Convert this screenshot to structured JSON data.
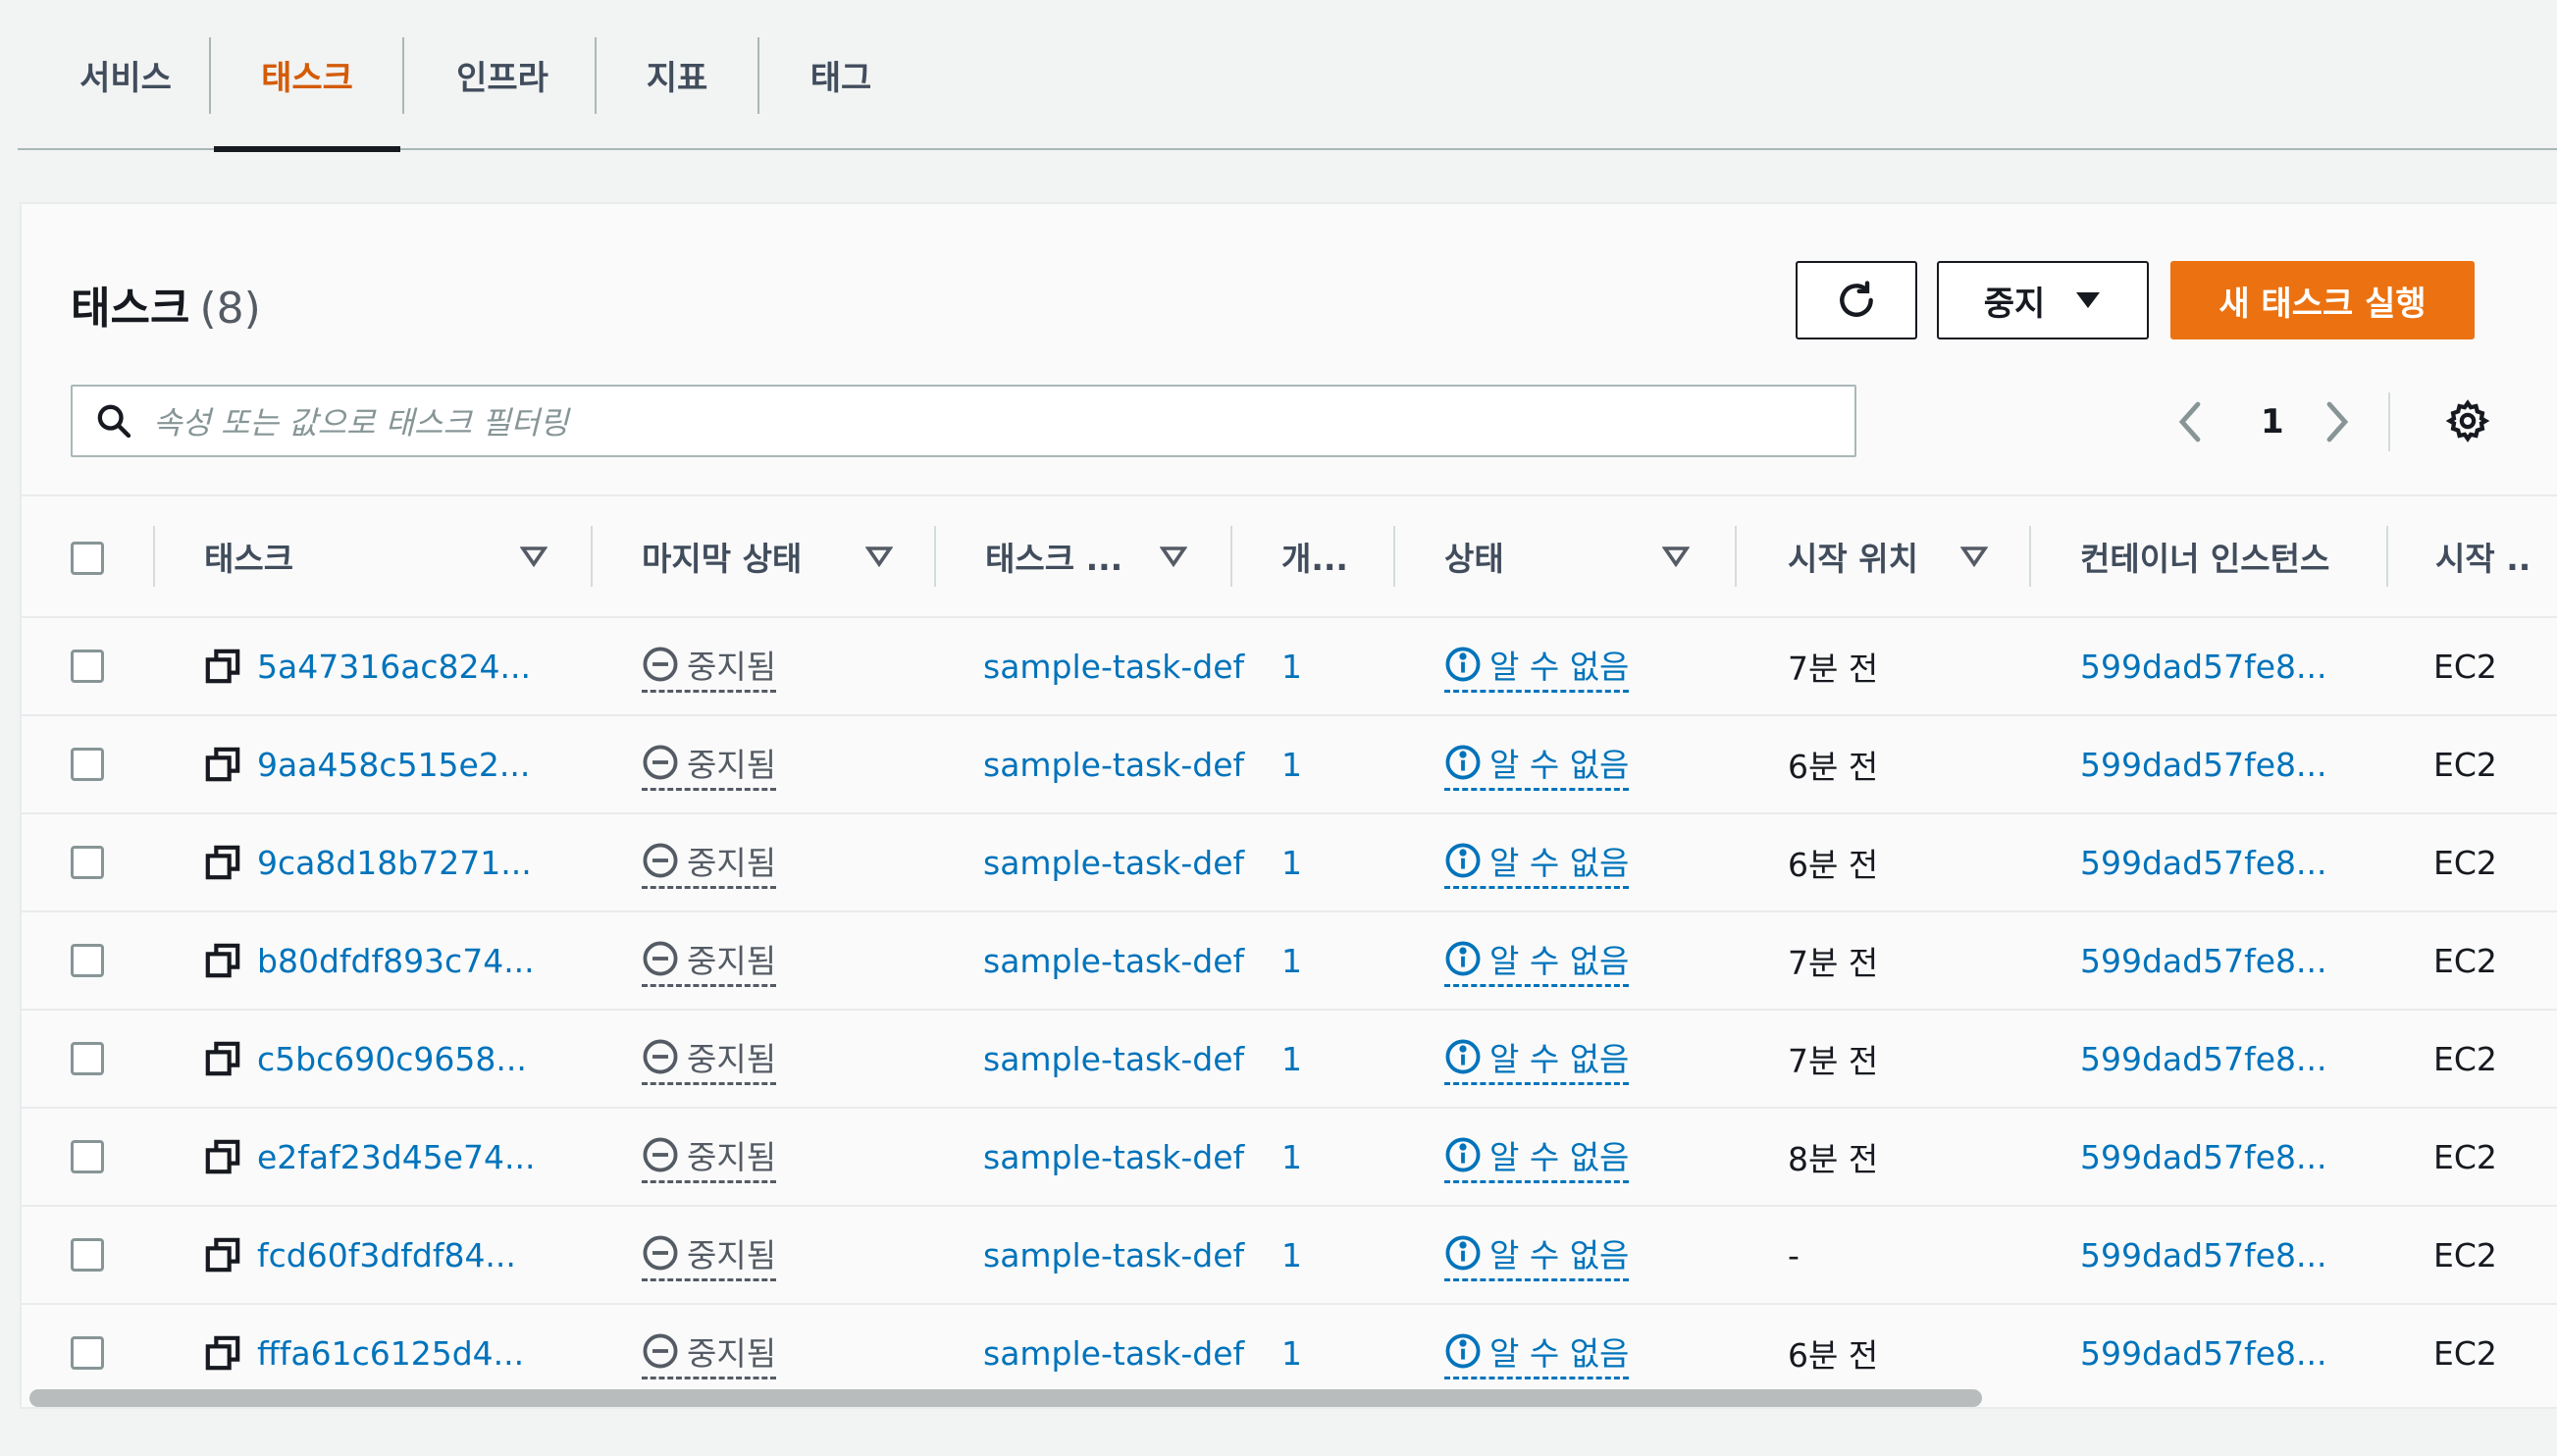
{
  "tabs": [
    {
      "label": "서비스"
    },
    {
      "label": "태스크"
    },
    {
      "label": "인프라"
    },
    {
      "label": "지표"
    },
    {
      "label": "태그"
    }
  ],
  "active_tab": "태스크",
  "panel": {
    "title": "태스크",
    "count": "(8)",
    "stop_button": "중지",
    "run_task_button": "새 태스크 실행",
    "search_placeholder": "속성 또는 값으로 태스크 필터링",
    "page_number": "1"
  },
  "columns": [
    {
      "label": "태스크"
    },
    {
      "label": "마지막 상태"
    },
    {
      "label": "태스크 ..."
    },
    {
      "label": "개..."
    },
    {
      "label": "상태"
    },
    {
      "label": "시작 위치"
    },
    {
      "label": "컨테이너 인스턴스"
    },
    {
      "label": "시작 .."
    }
  ],
  "rows": [
    {
      "task": "5a47316ac824...",
      "last_status": "중지됨",
      "task_def": "sample-task-def",
      "count": "1",
      "status": "알 수 없음",
      "started": "7분 전",
      "container_instance": "599dad57fe8...",
      "launch": "EC2"
    },
    {
      "task": "9aa458c515e2...",
      "last_status": "중지됨",
      "task_def": "sample-task-def",
      "count": "1",
      "status": "알 수 없음",
      "started": "6분 전",
      "container_instance": "599dad57fe8...",
      "launch": "EC2"
    },
    {
      "task": "9ca8d18b7271...",
      "last_status": "중지됨",
      "task_def": "sample-task-def",
      "count": "1",
      "status": "알 수 없음",
      "started": "6분 전",
      "container_instance": "599dad57fe8...",
      "launch": "EC2"
    },
    {
      "task": "b80dfdf893c74...",
      "last_status": "중지됨",
      "task_def": "sample-task-def",
      "count": "1",
      "status": "알 수 없음",
      "started": "7분 전",
      "container_instance": "599dad57fe8...",
      "launch": "EC2"
    },
    {
      "task": "c5bc690c9658...",
      "last_status": "중지됨",
      "task_def": "sample-task-def",
      "count": "1",
      "status": "알 수 없음",
      "started": "7분 전",
      "container_instance": "599dad57fe8...",
      "launch": "EC2"
    },
    {
      "task": "e2faf23d45e74...",
      "last_status": "중지됨",
      "task_def": "sample-task-def",
      "count": "1",
      "status": "알 수 없음",
      "started": "8분 전",
      "container_instance": "599dad57fe8...",
      "launch": "EC2"
    },
    {
      "task": "fcd60f3dfdf84...",
      "last_status": "중지됨",
      "task_def": "sample-task-def",
      "count": "1",
      "status": "알 수 없음",
      "started": "-",
      "container_instance": "599dad57fe8...",
      "launch": "EC2"
    },
    {
      "task": "fffa61c6125d4...",
      "last_status": "중지됨",
      "task_def": "sample-task-def",
      "count": "1",
      "status": "알 수 없음",
      "started": "6분 전",
      "container_instance": "599dad57fe8...",
      "launch": "EC2"
    }
  ],
  "icons": {
    "refresh": "refresh-icon",
    "dropdown": "caret-down-icon",
    "search": "search-icon",
    "prev": "chevron-left-icon",
    "next": "chevron-right-icon",
    "settings": "gear-icon",
    "sort": "sort-caret-icon",
    "external": "open-in-new-icon",
    "stopped": "minus-circle-icon",
    "info": "info-circle-icon"
  },
  "colors": {
    "accent": "#ec7211",
    "active_tab": "#d45b07",
    "link": "#0073bb"
  }
}
